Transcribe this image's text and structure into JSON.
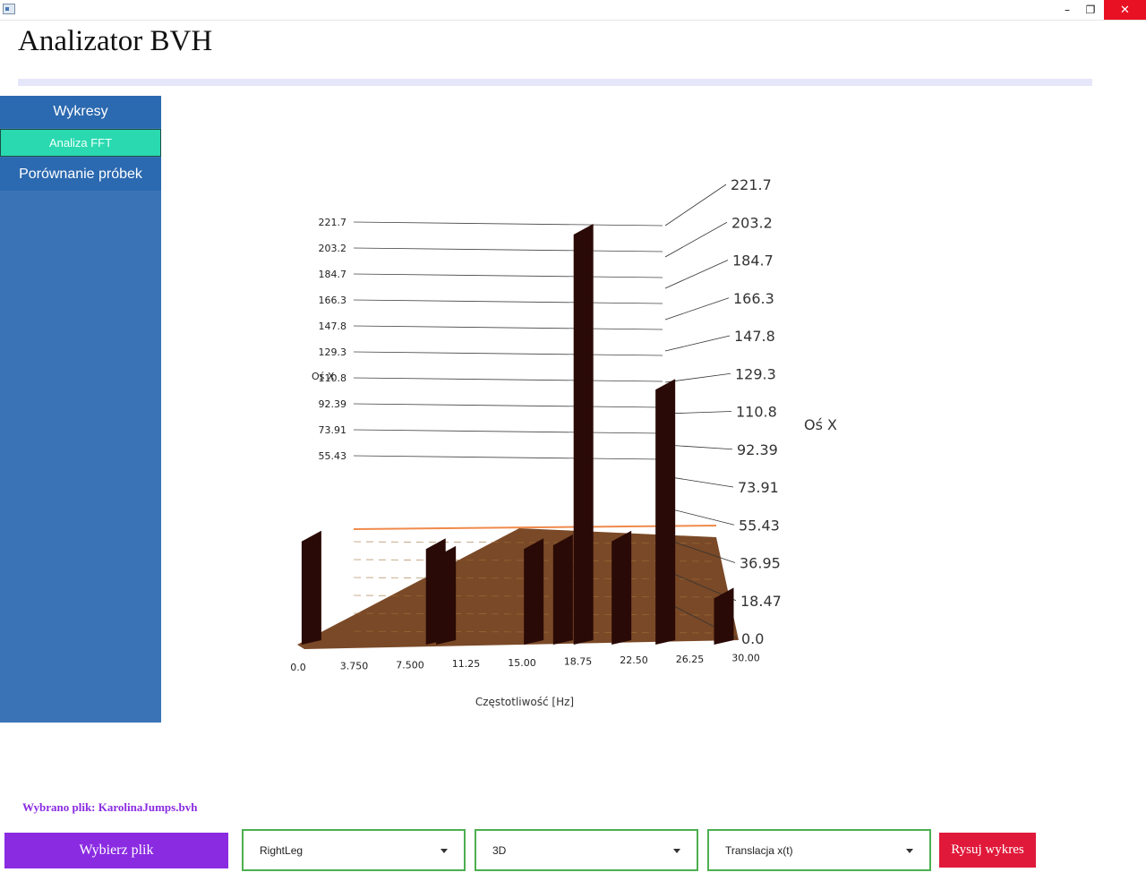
{
  "window": {
    "min_glyph": "–",
    "max_glyph": "❐",
    "close_glyph": "✕"
  },
  "app": {
    "title": "Analizator BVH"
  },
  "sidebar": {
    "items": [
      {
        "label": "Wykresy"
      },
      {
        "label": "Analiza FFT",
        "active": true
      },
      {
        "label": "Porównanie próbek"
      }
    ]
  },
  "chart_data": {
    "type": "3d-surface",
    "xlabel": "Częstotliwość [Hz]",
    "zlabel": "Oś X",
    "x_ticks": [
      "0.0",
      "3.750",
      "7.500",
      "11.25",
      "15.00",
      "18.75",
      "22.50",
      "26.25",
      "30.00"
    ],
    "z_ticks_back": [
      "221.7",
      "203.2",
      "184.7",
      "166.3",
      "147.8",
      "129.3",
      "110.8",
      "92.39",
      "73.91",
      "55.43"
    ],
    "z_ticks_right": [
      "221.7",
      "203.2",
      "184.7",
      "166.3",
      "147.8",
      "129.3",
      "110.8",
      "92.39",
      "73.91",
      "55.43",
      "36.95",
      "18.47",
      "0.0"
    ],
    "zlim": [
      0,
      221.7
    ],
    "xlim": [
      0,
      30
    ],
    "peaks": [
      {
        "x": 0.3,
        "value": 60
      },
      {
        "x": 8.8,
        "value": 56
      },
      {
        "x": 9.5,
        "value": 52
      },
      {
        "x": 15.5,
        "value": 56
      },
      {
        "x": 17.5,
        "value": 58
      },
      {
        "x": 18.9,
        "value": 221.7
      },
      {
        "x": 21.5,
        "value": 60
      },
      {
        "x": 24.5,
        "value": 140
      },
      {
        "x": 28.5,
        "value": 30
      }
    ],
    "colors": {
      "surface": "#2a0a06",
      "floor": "#6b3510",
      "edge": "#f08a4b"
    }
  },
  "footer": {
    "selected_file": "Wybrano plik: KarolinaJumps.bvh",
    "pick_button": "Wybierz plik",
    "bone_select": "RightLeg",
    "mode_select": "3D",
    "type_select": "Translacja x(t)",
    "draw_button": "Rysuj wykres"
  },
  "colors": {
    "sidebar": "#3b74b6",
    "active_nav": "#2ad9b0",
    "primary": "#8a2be2",
    "danger": "#e0193a",
    "select_border": "#4caf50"
  }
}
